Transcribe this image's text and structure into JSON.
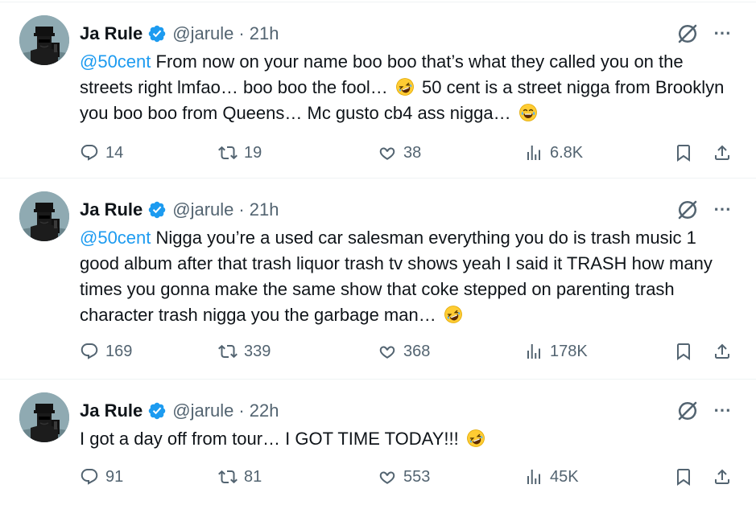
{
  "colors": {
    "accent": "#1d9bf0",
    "text": "#0f1419",
    "muted": "#536471",
    "divider": "#eff3f4"
  },
  "tweets": [
    {
      "name": "Ja Rule",
      "handle": "@jarule",
      "dot": "·",
      "time": "21h",
      "mention": "@50cent",
      "text_a": " From now on your name boo boo that’s what they called you on the streets right lmfao… boo boo the fool…",
      "text_b": " 50 cent is a street nigga from Brooklyn you boo boo from Queens… Mc gusto cb4 ass nigga…",
      "replies": "14",
      "reposts": "19",
      "likes": "38",
      "views": "6.8K"
    },
    {
      "name": "Ja Rule",
      "handle": "@jarule",
      "dot": "·",
      "time": "21h",
      "mention": "@50cent",
      "text_a": " Nigga you’re a used car salesman everything you do is trash music 1 good album after that trash liquor trash tv shows yeah I said it TRASH how many times you gonna make the same show that coke stepped on parenting trash character trash nigga you the garbage man…",
      "replies": "169",
      "reposts": "339",
      "likes": "368",
      "views": "178K"
    },
    {
      "name": "Ja Rule",
      "handle": "@jarule",
      "dot": "·",
      "time": "22h",
      "text_a": "I got a day off from tour… I GOT TIME TODAY!!!",
      "replies": "91",
      "reposts": "81",
      "likes": "553",
      "views": "45K"
    }
  ],
  "icons": {
    "more": "⋯",
    "reply": "reply-icon",
    "repost": "repost-icon",
    "like": "heart-icon",
    "views": "views-icon",
    "bookmark": "bookmark-icon",
    "share": "share-icon",
    "grok": "grok-icon",
    "verified": "verified-badge-icon"
  }
}
